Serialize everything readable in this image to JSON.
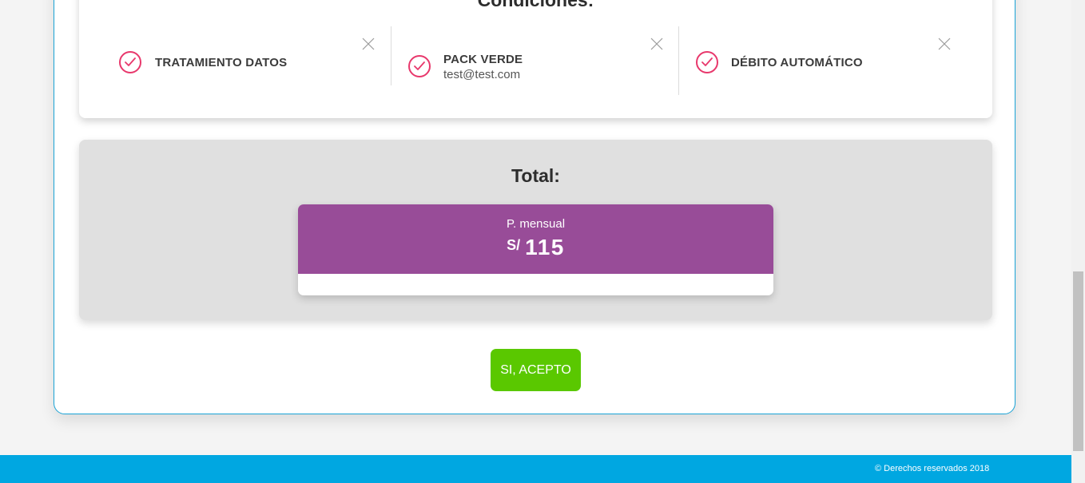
{
  "conditions": {
    "title": "Condiciones:",
    "items": [
      {
        "label": "TRATAMIENTO DATOS",
        "sub": ""
      },
      {
        "label": "PACK VERDE",
        "sub": "test@test.com"
      },
      {
        "label": "DÉBITO AUTOMÁTICO",
        "sub": ""
      }
    ]
  },
  "total": {
    "title": "Total:",
    "price_label": "P. mensual",
    "currency": "S/",
    "amount": "115"
  },
  "accept_button": "SI, ACEPTO",
  "footer": {
    "copyright": "© Derechos reservados 2018"
  },
  "colors": {
    "accent_pink": "#e8386c",
    "price_purple": "#984c98",
    "accept_green": "#5ac800",
    "footer_blue": "#00a7e1",
    "card_border": "#1aa3d6"
  }
}
